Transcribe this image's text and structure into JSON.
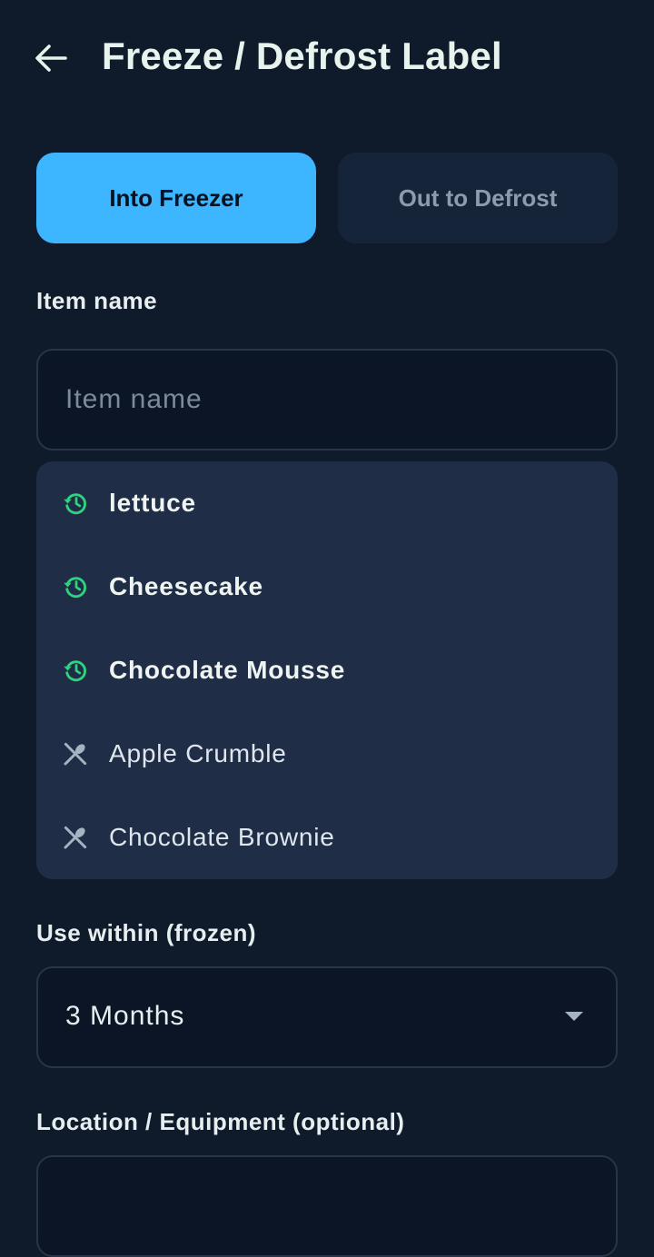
{
  "header": {
    "title": "Freeze / Defrost Label",
    "back_icon": "arrow-left-icon"
  },
  "mode_toggle": {
    "options": [
      "Into Freezer",
      "Out to Defrost"
    ],
    "selected": "Into Freezer",
    "active_color": "#3db5ff"
  },
  "item_name": {
    "label": "Item name",
    "placeholder": "Item name",
    "value": ""
  },
  "suggestions": {
    "items": [
      {
        "label": "lettuce",
        "kind": "recent",
        "icon": "history-icon"
      },
      {
        "label": "Cheesecake",
        "kind": "recent",
        "icon": "history-icon"
      },
      {
        "label": "Chocolate Mousse",
        "kind": "recent",
        "icon": "history-icon"
      },
      {
        "label": "Apple Crumble",
        "kind": "library",
        "icon": "utensils-icon"
      },
      {
        "label": "Chocolate Brownie",
        "kind": "library",
        "icon": "utensils-icon"
      }
    ],
    "recent_icon_color": "#2fd27f"
  },
  "use_within": {
    "label": "Use within (frozen)",
    "selected": "3 Months"
  },
  "location": {
    "label": "Location / Equipment (optional)",
    "value": ""
  }
}
